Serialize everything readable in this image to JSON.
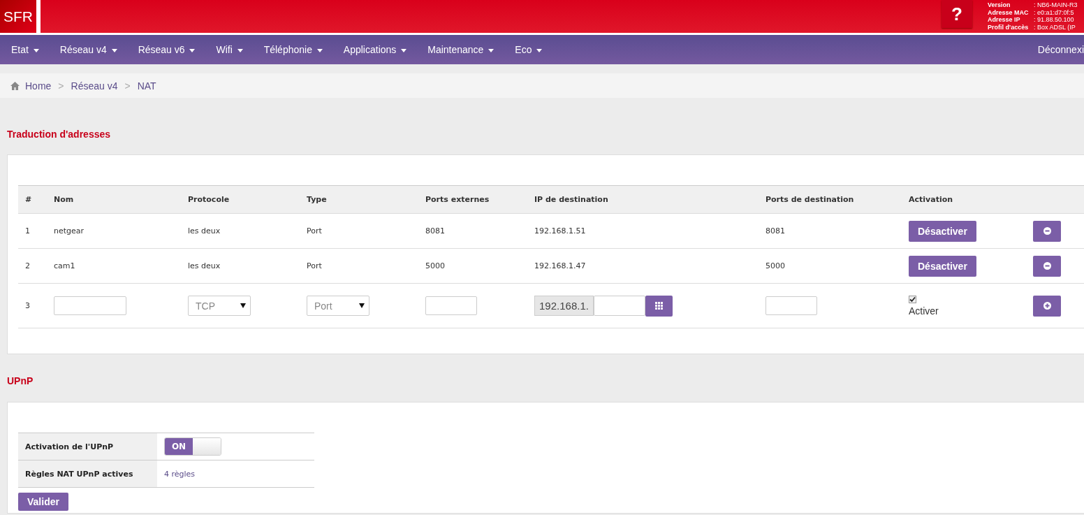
{
  "header": {
    "logo": "SFR",
    "help": "?",
    "info": [
      {
        "label": "Version",
        "value": ": NB6-MAIN-R3"
      },
      {
        "label": "Adresse MAC",
        "value": ": e0:a1:d7:0f:5"
      },
      {
        "label": "Adresse IP",
        "value": ": 91.88.50.100"
      },
      {
        "label": "Profil d'accès",
        "value": ":  Box ADSL (IP"
      }
    ]
  },
  "nav": {
    "items": [
      "Etat",
      "Réseau v4",
      "Réseau v6",
      "Wifi",
      "Téléphonie",
      "Applications",
      "Maintenance",
      "Eco"
    ],
    "logout": "Déconnexi"
  },
  "breadcrumb": {
    "items": [
      "Home",
      "Réseau v4",
      "NAT"
    ],
    "separator": ">"
  },
  "nat": {
    "title": "Traduction d'adresses",
    "columns": [
      "#",
      "Nom",
      "Protocole",
      "Type",
      "Ports externes",
      "IP de destination",
      "Ports de destination",
      "Activation"
    ],
    "rows": [
      {
        "index": "1",
        "name": "netgear",
        "protocol": "les deux",
        "type": "Port",
        "ext_ports": "8081",
        "dest_ip": "192.168.1.51",
        "dest_ports": "8081",
        "action": "Désactiver"
      },
      {
        "index": "2",
        "name": "cam1",
        "protocol": "les deux",
        "type": "Port",
        "ext_ports": "5000",
        "dest_ip": "192.168.1.47",
        "dest_ports": "5000",
        "action": "Désactiver"
      }
    ],
    "new_row": {
      "index": "3",
      "protocol": "TCP",
      "type": "Port",
      "ip_prefix": "192.168.1.",
      "activate_checked": true,
      "activate_label": "Activer"
    }
  },
  "upnp": {
    "title": "UPnP",
    "rows": [
      {
        "kind": "toggle",
        "label": "Activation de l'UPnP",
        "on": true,
        "on_text": "ON"
      },
      {
        "kind": "link",
        "label": "Règles NAT UPnP actives",
        "value": "4 règles"
      }
    ],
    "submit": "Valider"
  }
}
